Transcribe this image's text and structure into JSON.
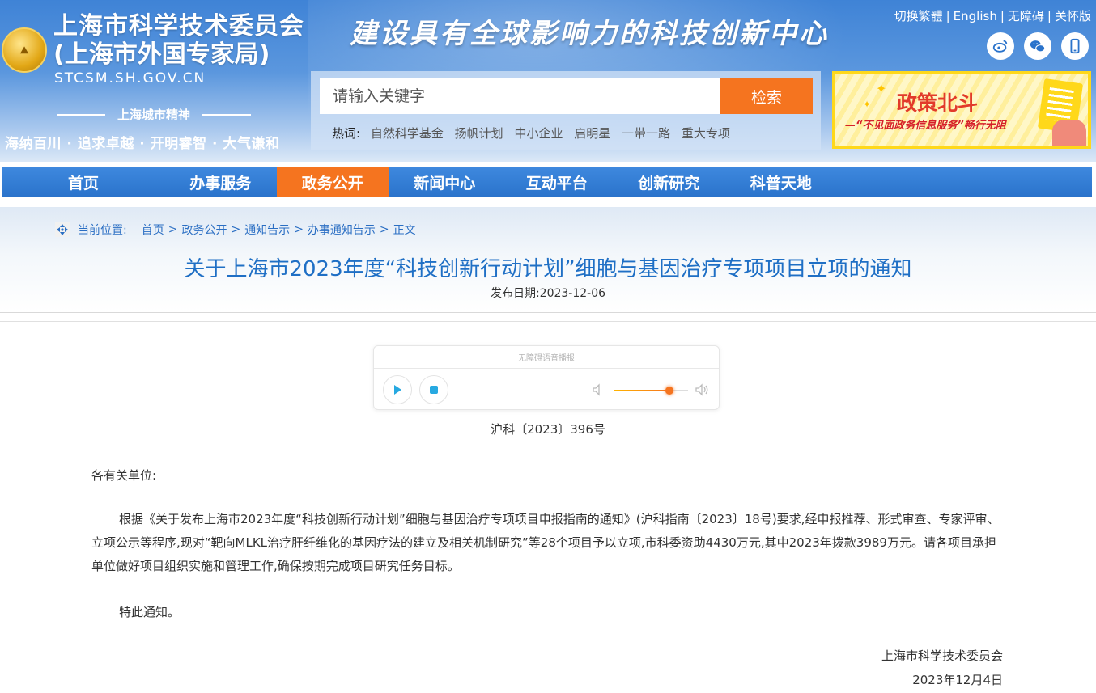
{
  "header": {
    "org_name": "上海市科学技术委员会",
    "org_sub": "(上海市外国专家局)",
    "domain": "STCSM.SH.GOV.CN",
    "spirit_title": "上海城市精神",
    "spirit_text": "海纳百川 · 追求卓越 · 开明睿智 · 大气谦和",
    "slogan": "建设具有全球影响力的科技创新中心",
    "top_links": [
      "切换繁體",
      "English",
      "无障碍",
      "关怀版"
    ],
    "social_icons": [
      "weibo-icon",
      "wechat-icon",
      "mobile-icon"
    ],
    "colors": {
      "header_blue": "#3f83d6",
      "accent_orange": "#f5741f"
    }
  },
  "search": {
    "placeholder": "请输入关键字",
    "button_label": "检索",
    "hot_label": "热词:",
    "hot_words": [
      "自然科学基金",
      "扬帆计划",
      "中小企业",
      "启明星",
      "一带一路",
      "重大专项"
    ]
  },
  "banner": {
    "title": "政策北斗",
    "subtitle": "—“不见面政务信息服务”畅行无阻"
  },
  "nav": {
    "items": [
      "首页",
      "办事服务",
      "政务公开",
      "新闻中心",
      "互动平台",
      "创新研究",
      "科普天地"
    ],
    "active": "政务公开"
  },
  "breadcrumb": {
    "label": "当前位置:",
    "items": [
      "首页",
      "政务公开",
      "通知告示",
      "办事通知告示",
      "正文"
    ],
    "separators": [
      ">",
      ">",
      ">",
      ">"
    ]
  },
  "article": {
    "title": "关于上海市2023年度“科技创新行动计划”细胞与基因治疗专项项目立项的通知",
    "pub_date": "发布日期:2023-12-06",
    "doc_number": "沪科〔2023〕396号",
    "salutation": "各有关单位:",
    "paragraph_1": "根据《关于发布上海市2023年度“科技创新行动计划”细胞与基因治疗专项项目申报指南的通知》(沪科指南〔2023〕18号)要求,经申报推荐、形式审查、专家评审、立项公示等程序,现对“靶向MLKL治疗肝纤维化的基因疗法的建立及相关机制研究”等28个项目予以立项,市科委资助4430万元,其中2023年拨款3989万元。请各项目承担单位做好项目组织实施和管理工作,确保按期完成项目研究任务目标。",
    "paragraph_2": "特此通知。",
    "signer": "上海市科学技术委员会",
    "sign_date": "2023年12月4日"
  },
  "player": {
    "caption": "无障碍语音播报",
    "volume_level": 0.75
  }
}
